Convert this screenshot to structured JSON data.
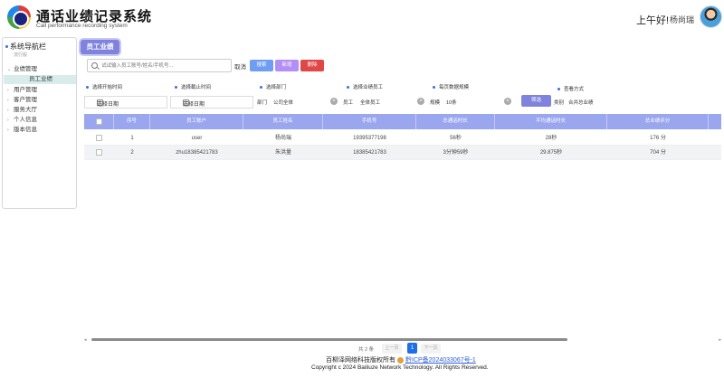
{
  "header": {
    "title": "通话业绩记录系统",
    "subtitle": "Call performance recording system",
    "greeting": "上午好!",
    "username": "杨尚瑞"
  },
  "sidebar": {
    "title": "系统导航栏",
    "subtitle": "流行般",
    "items": [
      {
        "label": "业绩管理",
        "chevron": "⌄"
      },
      {
        "label": "用户管理",
        "chevron": "›"
      },
      {
        "label": "客户管理",
        "chevron": "›"
      },
      {
        "label": "服务大厅",
        "chevron": "›"
      },
      {
        "label": "个人信息",
        "chevron": "›"
      },
      {
        "label": "版本信息",
        "chevron": "›"
      }
    ],
    "active_sub_item": "员工业绩"
  },
  "main": {
    "tab_label": "员工业绩",
    "search_placeholder": "试试输入员工账号/姓名/手机号...",
    "cancel_label": "取消",
    "search_button": "搜索",
    "add_button": "新增",
    "delete_button": "删除"
  },
  "filters": {
    "start_label": "选择开始时间",
    "end_label": "选择截止时间",
    "dept_label": "选择部门",
    "staff_label": "选择业绩员工",
    "pagesize_label": "每页数据规模",
    "view_label": "查看方式",
    "start_value": "选择日期",
    "end_value": "选择日期",
    "dept_prefix": "部门",
    "dept_value": "公司全体",
    "staff_prefix": "员工",
    "staff_value": "全体员工",
    "pagesize_prefix": "规模",
    "pagesize_value": "10条",
    "filter_button": "筛选",
    "view_prefix": "类别",
    "view_value": "合并总业绩"
  },
  "table": {
    "headers": [
      "序号",
      "员工账户",
      "员工姓名",
      "手机号",
      "总通话时长",
      "平均通话时长",
      "总业绩评分"
    ],
    "rows": [
      [
        "1",
        "user",
        "杨尚瑞",
        "19395377198",
        "56秒",
        "28秒",
        "176 分"
      ],
      [
        "2",
        "zhu18385421783",
        "朱洪量",
        "18385421783",
        "3分钟59秒",
        "29.875秒",
        "704 分"
      ]
    ]
  },
  "scroll": {
    "left_arrow": "◂",
    "right_arrow": "▸"
  },
  "pagination": {
    "total": "共 2 条",
    "prev": "上一页",
    "current": "1",
    "next": "下一页"
  },
  "footer": {
    "rights": "百柳泽网络科技版权所有",
    "icp": "黔ICP备2024033067号-1",
    "copyright": "Copyright c 2024 Bailiuze Network Technology. All Rights Reserved."
  }
}
